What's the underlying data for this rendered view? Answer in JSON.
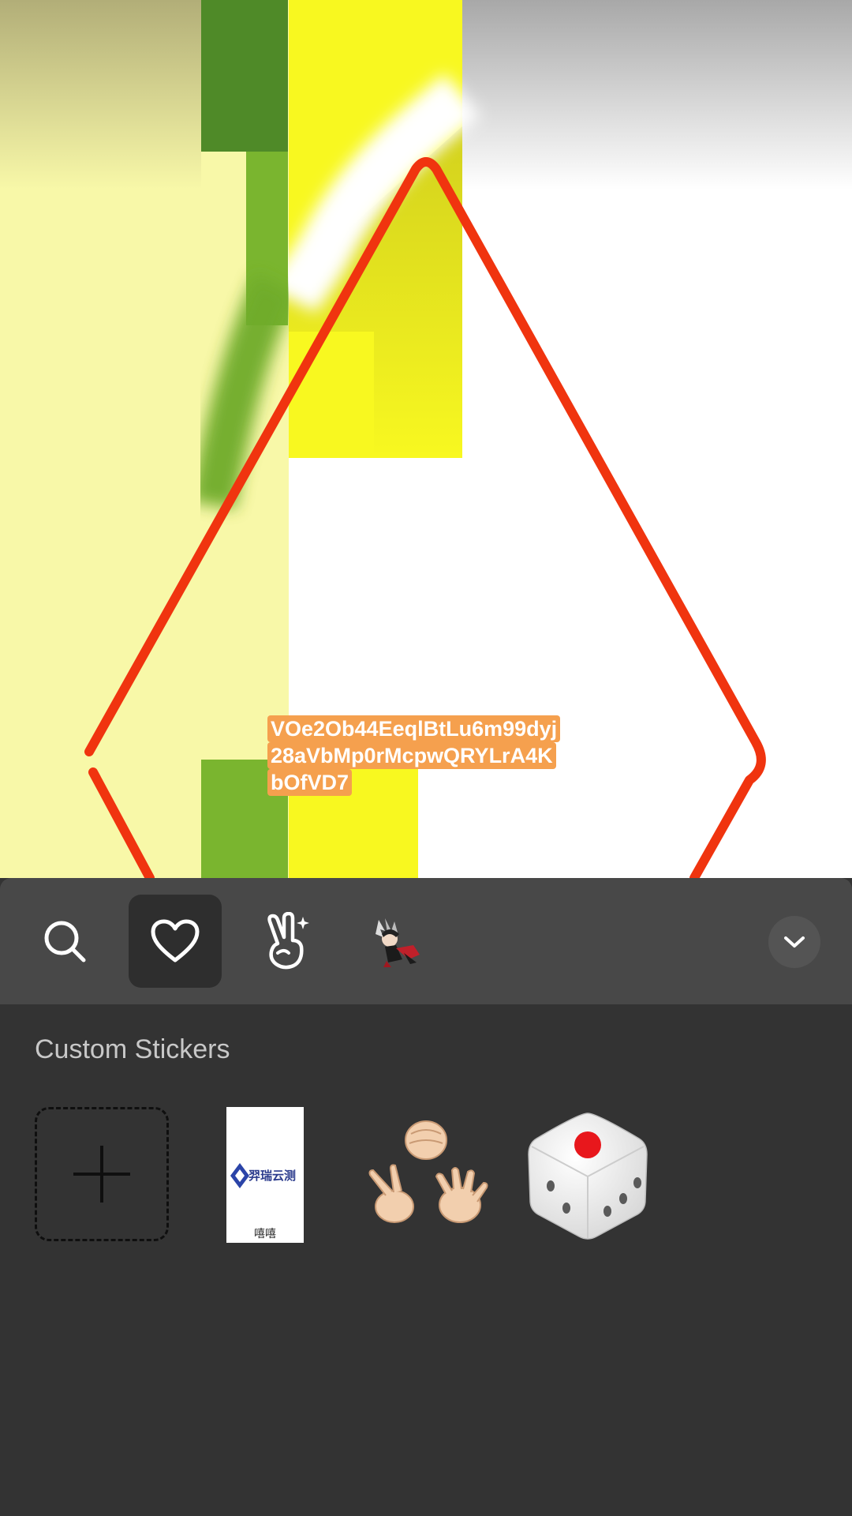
{
  "canvas": {
    "text_sticker": {
      "lines": [
        "VOe2Ob44EeqlBtLu6m99dyj",
        "28aVbMp0rMcpwQRYLrA4K",
        "bOfVD7"
      ]
    },
    "colors": {
      "outline": "#f0340f",
      "text_background": "#f5a04e",
      "pale_yellow": "#f8f8a8",
      "green": "#7ab52f",
      "yellow": "#f8f820"
    }
  },
  "sticker_panel": {
    "tabs": [
      {
        "name": "search",
        "icon": "search-icon",
        "active": false
      },
      {
        "name": "favorites",
        "icon": "heart-icon",
        "active": true
      },
      {
        "name": "gestures",
        "icon": "peace-hand-icon",
        "active": false
      },
      {
        "name": "anime",
        "icon": "anime-character-icon",
        "active": false
      }
    ],
    "collapse_icon": "chevron-down-icon",
    "section_title": "Custom Stickers",
    "stickers": [
      {
        "name": "add-sticker",
        "icon": "plus-icon"
      },
      {
        "name": "logo-sticker",
        "logo_text": "羿瑞云测",
        "caption": "嘻嘻"
      },
      {
        "name": "rock-paper-scissors-sticker",
        "icon": "rock-paper-scissors-icon"
      },
      {
        "name": "dice-sticker",
        "icon": "dice-icon"
      }
    ],
    "colors": {
      "panel": "#333333",
      "tabbar": "#484848",
      "active_tab": "#2e2e2e",
      "section_title": "#c8c8c8"
    }
  }
}
